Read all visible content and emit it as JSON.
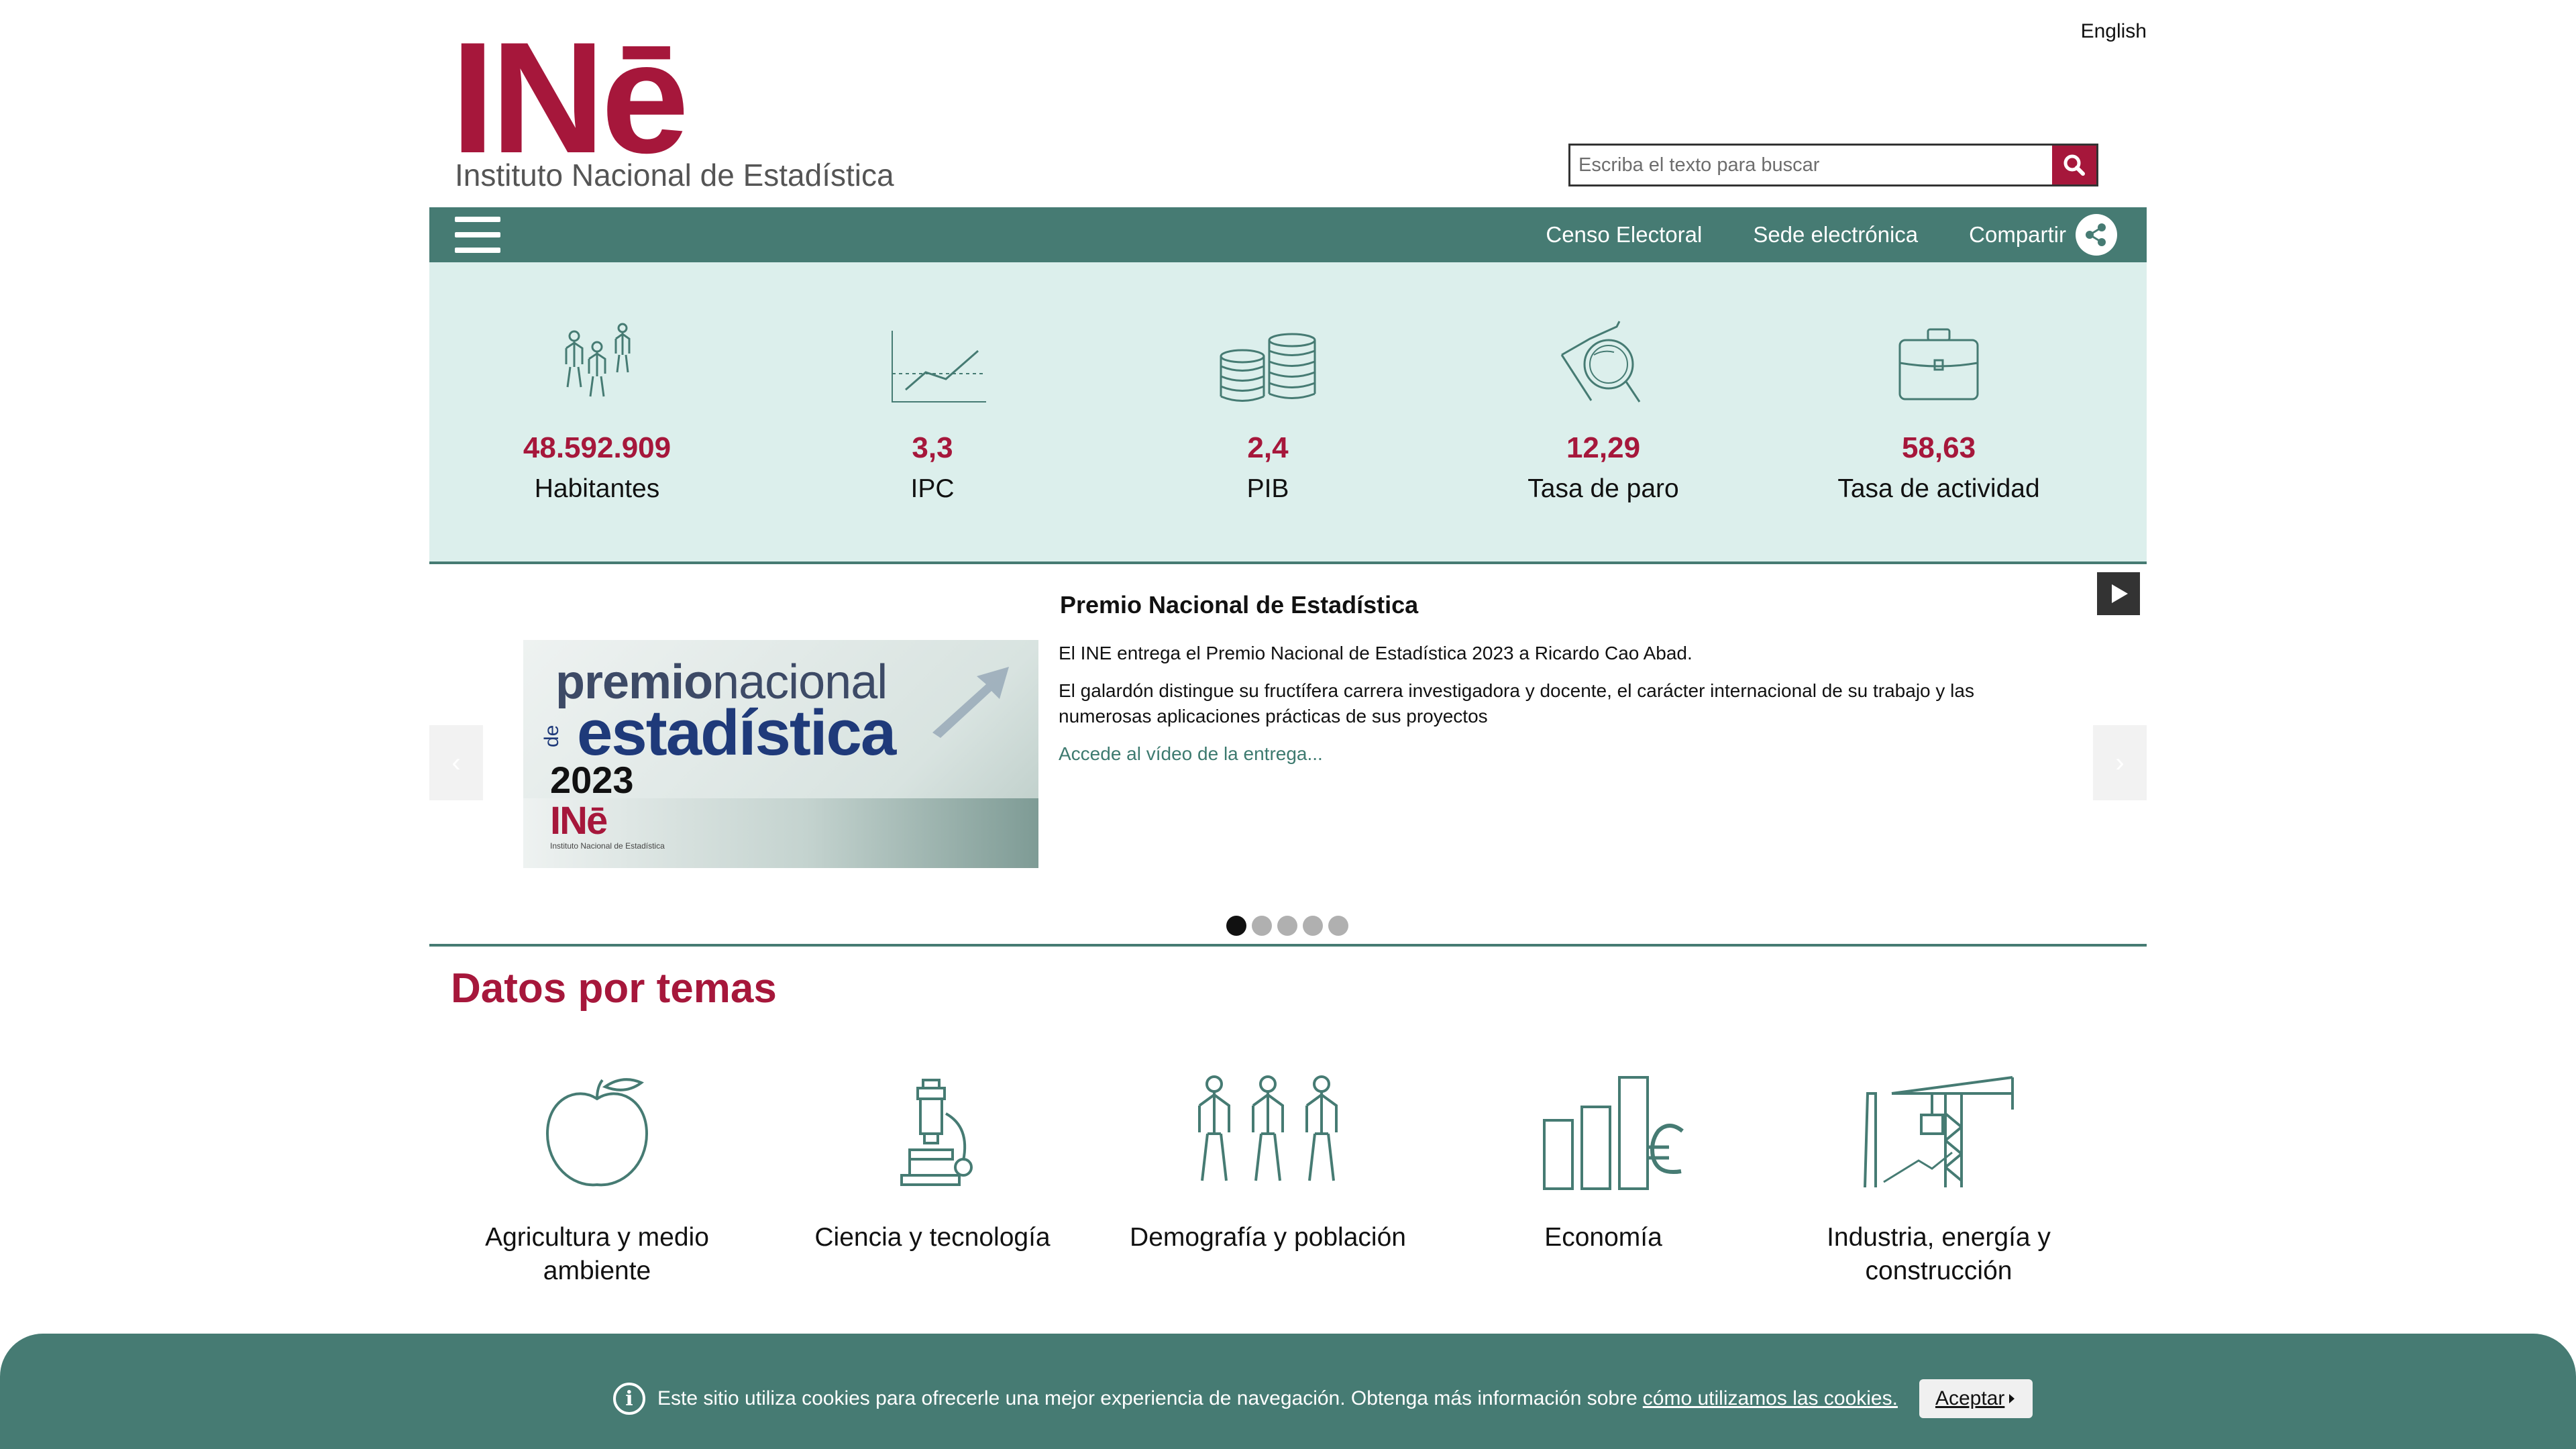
{
  "header": {
    "logo_text": "INē",
    "logo_subtitle": "Instituto Nacional de Estadística",
    "language_link": "English",
    "search": {
      "placeholder": "Escriba el texto para buscar",
      "icon": "search-icon"
    }
  },
  "nav": {
    "menu_icon": "hamburger-menu-icon",
    "links": [
      "Censo Electoral",
      "Sede electrónica",
      "Compartir"
    ],
    "share_icon": "share-icon",
    "color": "#467b73"
  },
  "stats": [
    {
      "value": "48.592.909",
      "label": "Habitantes",
      "icon": "people-icon"
    },
    {
      "value": "3,3",
      "label": "IPC",
      "icon": "line-chart-icon"
    },
    {
      "value": "2,4",
      "label": "PIB",
      "icon": "coins-icon"
    },
    {
      "value": "12,29",
      "label": "Tasa de paro",
      "icon": "magnifier-icon"
    },
    {
      "value": "58,63",
      "label": "Tasa de actividad",
      "icon": "briefcase-icon"
    }
  ],
  "carousel": {
    "title": "Premio Nacional de Estadística",
    "image": {
      "line1_normal": "premio",
      "line1_light": "nacional",
      "line2_de": "de",
      "line2": "estadística",
      "year": "2023",
      "logo": "INē",
      "logo_sub": "Instituto Nacional de Estadística"
    },
    "paragraphs": [
      "El INE entrega el Premio Nacional de Estadística 2023 a Ricardo Cao Abad.",
      "El galardón distingue su fructífera carrera investigadora y docente, el carácter internacional de su trabajo y las numerosas aplicaciones prácticas de sus proyectos"
    ],
    "link": "Accede al vídeo de la entrega...",
    "prev": "‹",
    "next": "›",
    "slide_count": 5,
    "active_slide": 1
  },
  "temas": {
    "title": "Datos por temas",
    "items": [
      {
        "label": "Agricultura y medio ambiente",
        "icon": "apple-icon"
      },
      {
        "label": "Ciencia y tecnología",
        "icon": "microscope-icon"
      },
      {
        "label": "Demografía y población",
        "icon": "population-icon"
      },
      {
        "label": "Economía",
        "icon": "euro-chart-icon"
      },
      {
        "label": "Industria, energía y construcción",
        "icon": "crane-icon"
      }
    ]
  },
  "cookie": {
    "icon": "info-icon",
    "text": "Este sitio utiliza cookies para ofrecerle una mejor experiencia de navegación. Obtenga más información sobre",
    "link": "cómo utilizamos las cookies.",
    "button": "Aceptar"
  },
  "colors": {
    "brand": "#a6173b",
    "accent": "#467b73",
    "stats_bg": "#dcefec"
  }
}
